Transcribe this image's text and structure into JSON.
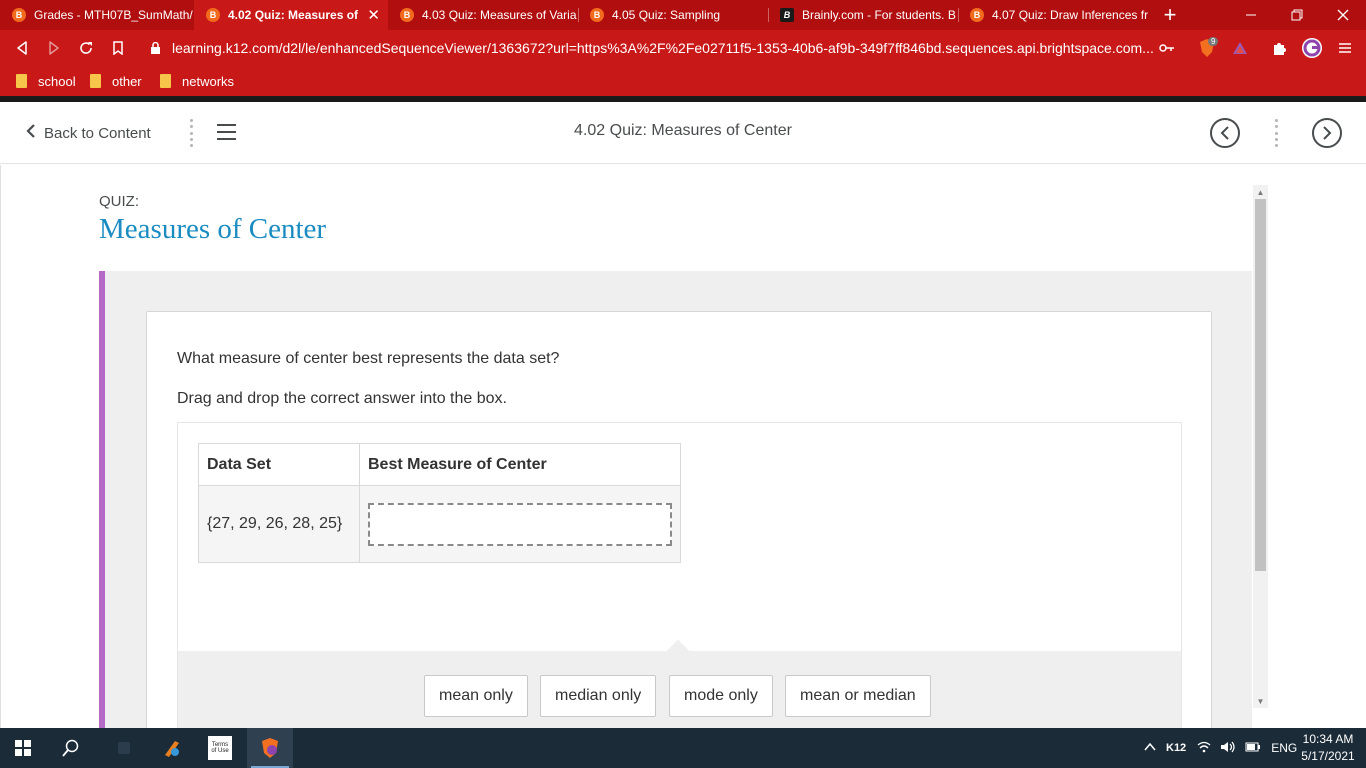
{
  "browser": {
    "tabs": [
      {
        "title": "Grades - MTH07B_SumMath/",
        "favicon": "B",
        "active": false
      },
      {
        "title": "4.02 Quiz: Measures of C",
        "favicon": "B",
        "active": true
      },
      {
        "title": "4.03 Quiz: Measures of Varia",
        "favicon": "B",
        "active": false
      },
      {
        "title": "4.05 Quiz: Sampling",
        "favicon": "B",
        "active": false
      },
      {
        "title": "Brainly.com - For students. B",
        "favicon": "B",
        "active": false
      },
      {
        "title": "4.07 Quiz: Draw Inferences fr",
        "favicon": "B",
        "active": false
      }
    ],
    "close_glyph": "✕",
    "new_tab_glyph": "+",
    "url": "learning.k12.com/d2l/le/enhancedSequenceViewer/1363672?url=https%3A%2F%2Fe02711f5-1353-40b6-af9b-349f7ff846bd.sequences.api.brightspace.com...",
    "shield_badge": "9",
    "bookmarks": [
      "school",
      "other",
      "networks"
    ],
    "accent": "#c81818"
  },
  "d2l": {
    "back_label": "Back to Content",
    "title": "4.02 Quiz: Measures of Center"
  },
  "quiz": {
    "label": "QUIZ:",
    "title": "Measures of Center",
    "question": "What measure of center best represents the data set?",
    "instruction": "Drag and drop the correct answer into the box.",
    "table": {
      "headers": [
        "Data Set",
        "Best Measure of Center"
      ],
      "data_set": "{27, 29, 26, 28, 25}",
      "answer": ""
    },
    "choices": [
      "mean only",
      "median only",
      "mode only",
      "mean or median"
    ],
    "title_color": "#1a8cc1",
    "accent_bar_color": "#b56ac8"
  },
  "taskbar": {
    "tray_label": "K12",
    "language": "ENG",
    "time": "10:34 AM",
    "date": "5/17/2021",
    "pinned_label": "Terms of Use"
  }
}
